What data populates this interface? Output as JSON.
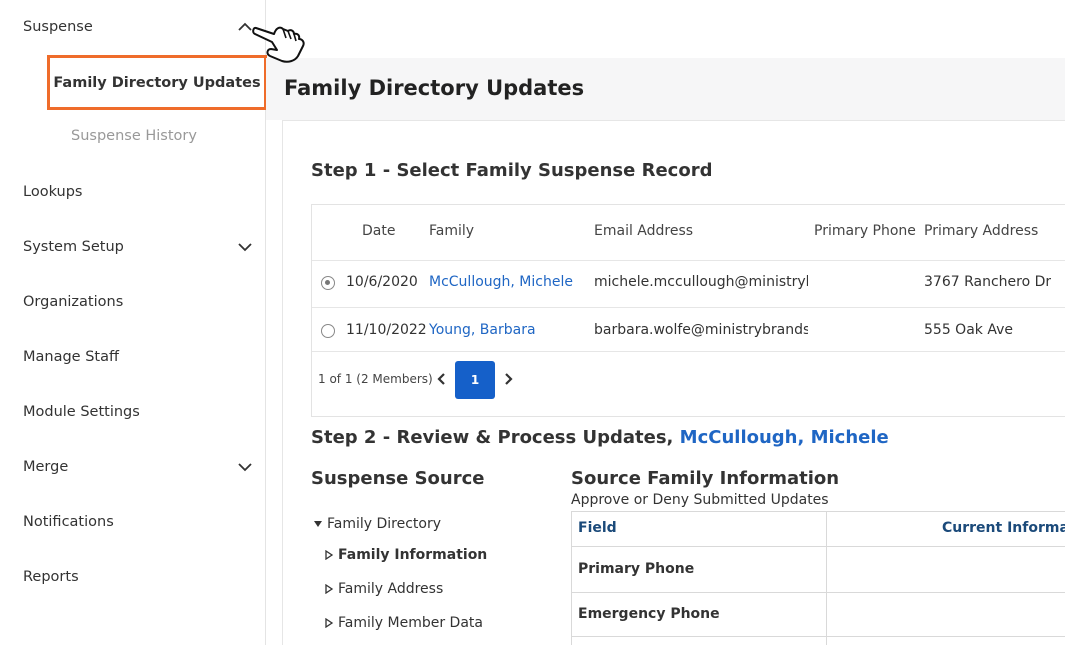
{
  "sidebar": {
    "items": [
      {
        "label": "Suspense",
        "chevron": "up"
      },
      {
        "label": "Lookups"
      },
      {
        "label": "System Setup",
        "chevron": "down"
      },
      {
        "label": "Organizations"
      },
      {
        "label": "Manage Staff"
      },
      {
        "label": "Module Settings"
      },
      {
        "label": "Merge",
        "chevron": "down"
      },
      {
        "label": "Notifications"
      },
      {
        "label": "Reports"
      }
    ],
    "suspense_sub": {
      "active": "Family Directory Updates",
      "history": "Suspense History"
    },
    "active_highlight_color": "#ef6c2a"
  },
  "page": {
    "title": "Family Directory Updates"
  },
  "step1": {
    "title": "Step 1 - Select Family Suspense Record",
    "columns": [
      "Date",
      "Family",
      "Email Address",
      "Primary Phone",
      "Primary Address"
    ],
    "rows": [
      {
        "selected": true,
        "date": "10/6/2020",
        "family": "McCullough, Michele",
        "email": "michele.mccullough@ministrybr",
        "phone": "",
        "address": "3767 Ranchero Dr"
      },
      {
        "selected": false,
        "date": "11/10/2022",
        "family": "Young, Barbara",
        "email": "barbara.wolfe@ministrybrands.c",
        "phone": "",
        "address": "555 Oak Ave"
      }
    ],
    "pager": {
      "summary": "1 of 1 (2 Members)",
      "current_page": "1"
    }
  },
  "step2": {
    "title_prefix": "Step 2 - Review & Process Updates, ",
    "family_name": "McCullough, Michele",
    "suspense_source": {
      "title": "Suspense Source",
      "root": "Family Directory",
      "children": [
        "Family Information",
        "Family Address",
        "Family Member Data"
      ],
      "selected_child": "Family Information"
    },
    "source_info": {
      "title": "Source Family Information",
      "subtitle": "Approve or Deny Submitted Updates",
      "headers": [
        "Field",
        "Current Informa"
      ],
      "rows": [
        "Primary Phone",
        "Emergency Phone"
      ]
    }
  },
  "colors": {
    "link": "#1f66c4",
    "primary_button": "#1560c9",
    "header_band": "#f6f6f7"
  }
}
